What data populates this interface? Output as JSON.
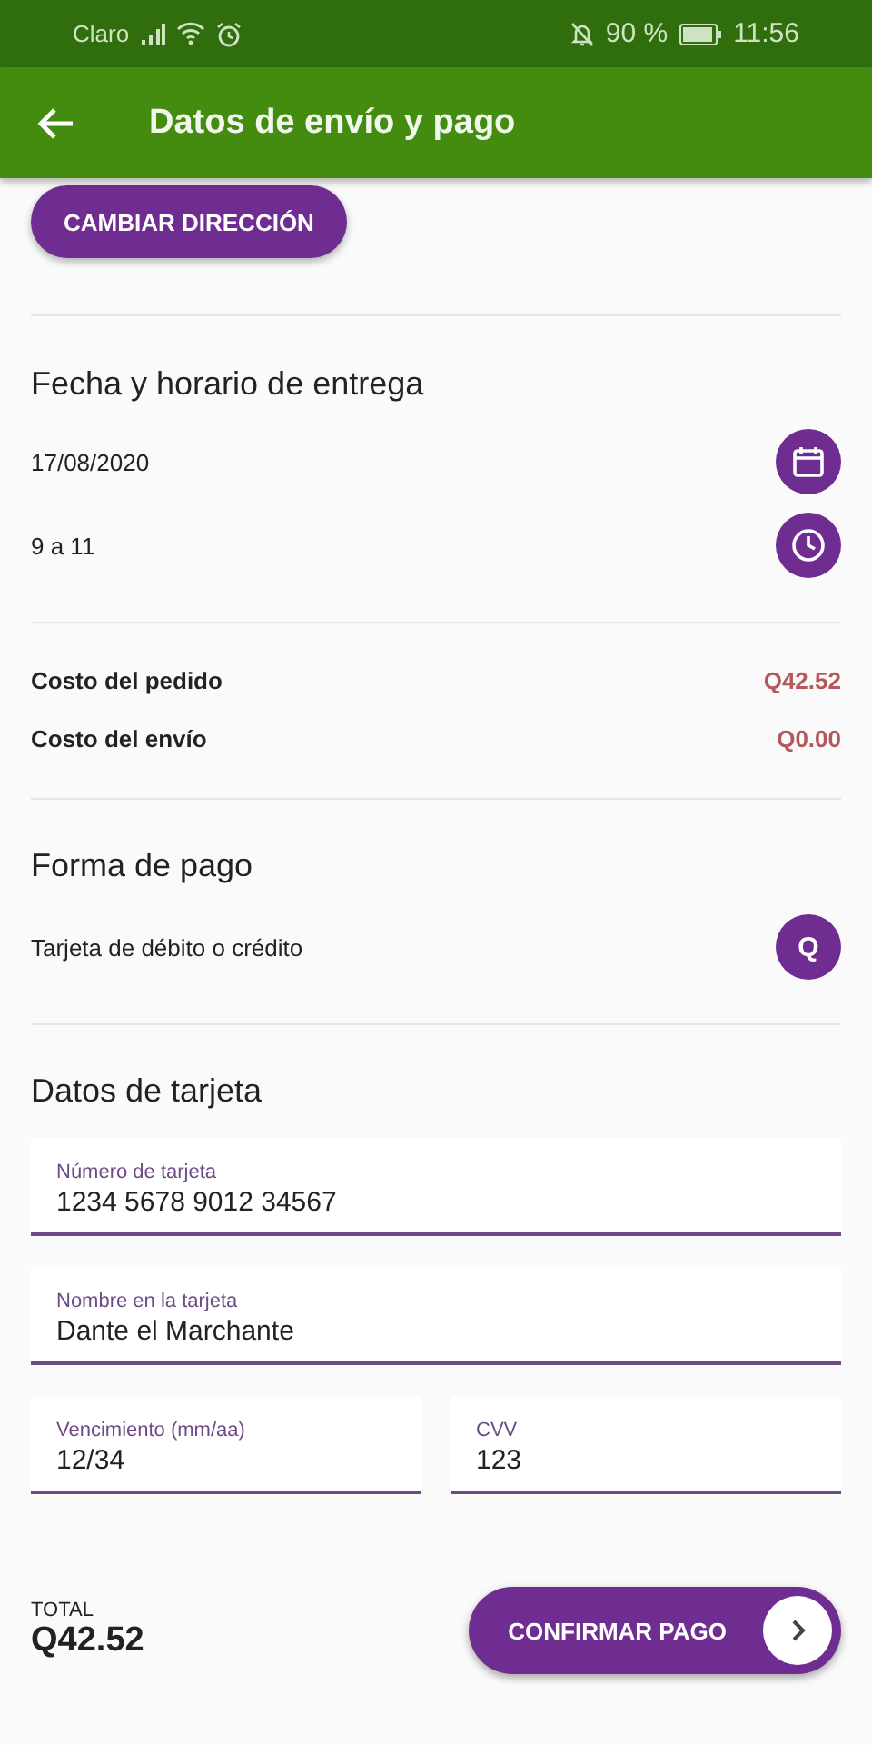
{
  "status_bar": {
    "carrier": "Claro",
    "battery": "90 %",
    "time": "11:56"
  },
  "app_bar": {
    "title": "Datos de envío y pago"
  },
  "address_button": "CAMBIAR DIRECCIÓN",
  "delivery": {
    "title": "Fecha y horario de entrega",
    "date": "17/08/2020",
    "time": "9 a 11"
  },
  "costs": [
    {
      "label": "Costo del pedido",
      "value": "Q42.52"
    },
    {
      "label": "Costo del envío",
      "value": "Q0.00"
    }
  ],
  "payment": {
    "title": "Forma de pago",
    "method": "Tarjeta de débito o crédito",
    "button": "Q"
  },
  "card": {
    "title": "Datos de tarjeta",
    "fields": [
      {
        "label": "Número de tarjeta",
        "value": "1234 5678 9012 34567"
      },
      {
        "label": "Nombre en la tarjeta",
        "value": "Dante el Marchante"
      },
      {
        "label": "Vencimiento (mm/aa)",
        "value": "12/34"
      },
      {
        "label": "CVV",
        "value": "123"
      }
    ]
  },
  "footer": {
    "total_label": "TOTAL",
    "total": "Q42.52",
    "confirm_button": "CONFIRMAR PAGO"
  }
}
